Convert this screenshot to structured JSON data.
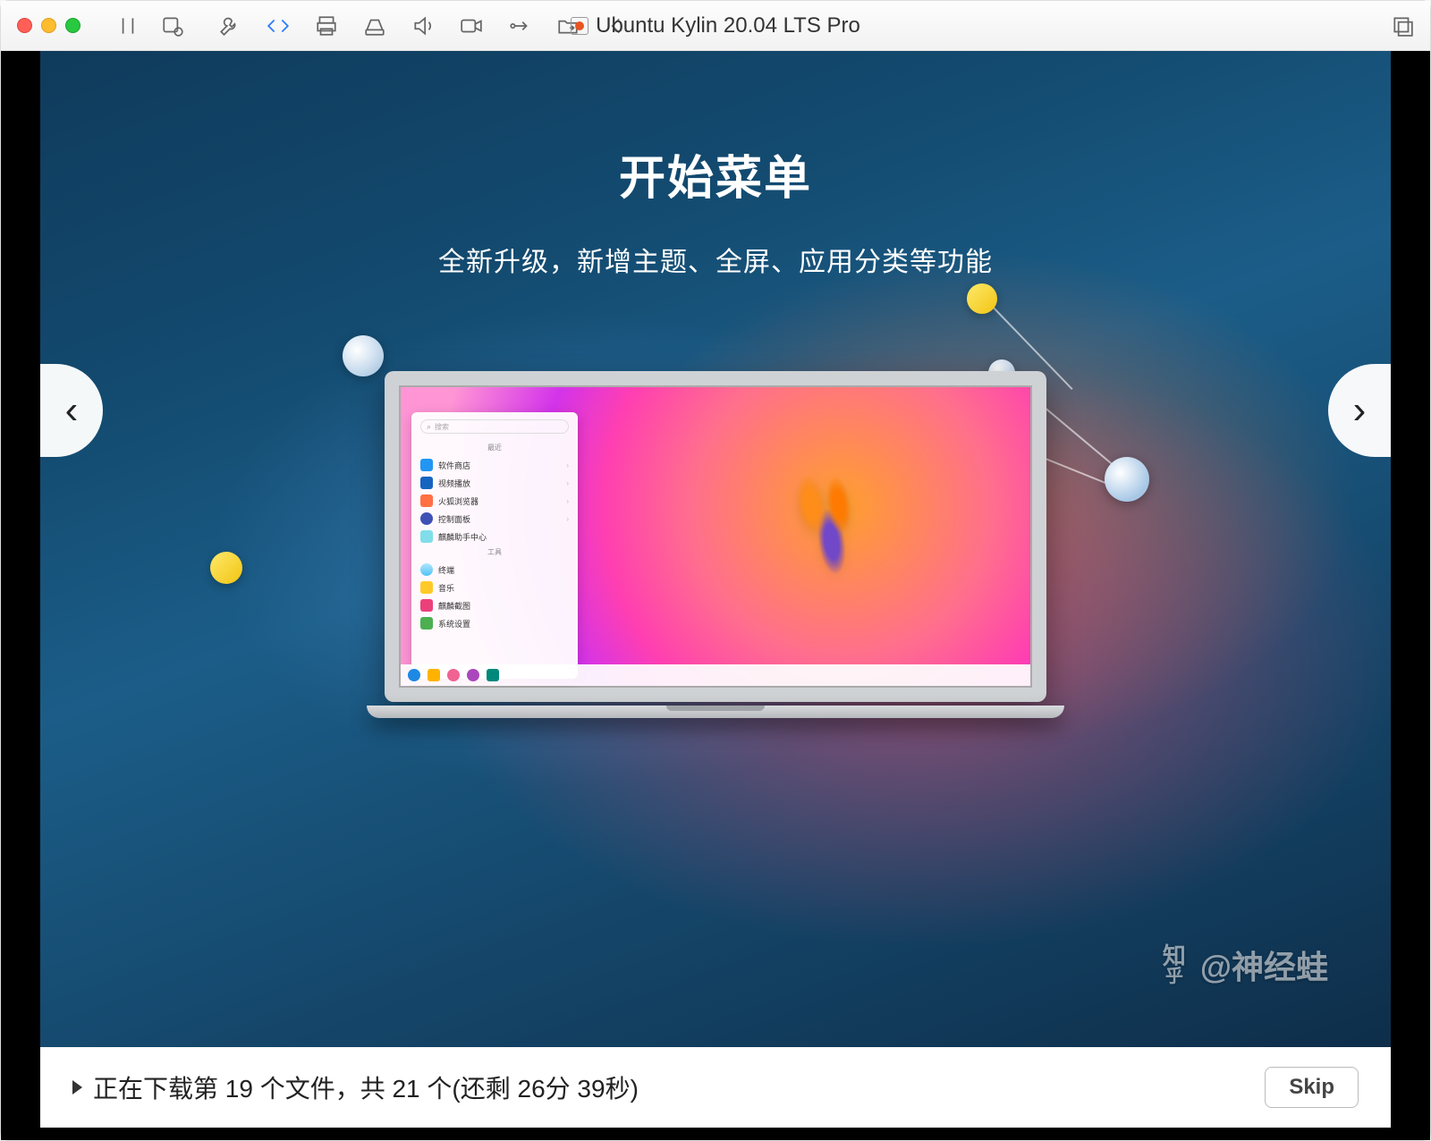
{
  "titlebar": {
    "window_title": "Ubuntu Kylin 20.04 LTS Pro"
  },
  "toolbar_icons": {
    "pause": "pause-icon",
    "snapshot": "snapshot-icon",
    "wrench": "wrench-icon",
    "code": "code-icon",
    "printer": "printer-icon",
    "drive": "drive-icon",
    "sound": "sound-icon",
    "camera": "camera-icon",
    "usb": "usb-icon",
    "share": "share-icon",
    "back": "back-icon",
    "expand": "expand-icon"
  },
  "slideshow": {
    "title": "开始菜单",
    "subtitle": "全新升级，新增主题、全屏、应用分类等功能",
    "prev_label": "‹",
    "next_label": "›"
  },
  "start_menu": {
    "search_placeholder": "搜索",
    "section_recent": "最近",
    "section_all": "工具",
    "items_recent": [
      "软件商店",
      "视频播放",
      "火狐浏览器",
      "控制面板",
      "麒麟助手中心"
    ],
    "items_all": [
      "终端",
      "音乐",
      "麒麟截图",
      "系统设置"
    ]
  },
  "status": {
    "text": "正在下载第 19 个文件，共 21 个(还剩 26分 39秒)",
    "skip_label": "Skip"
  },
  "watermark": {
    "site_top": "知",
    "site_bottom": "乎",
    "author": "@神经蛙"
  }
}
